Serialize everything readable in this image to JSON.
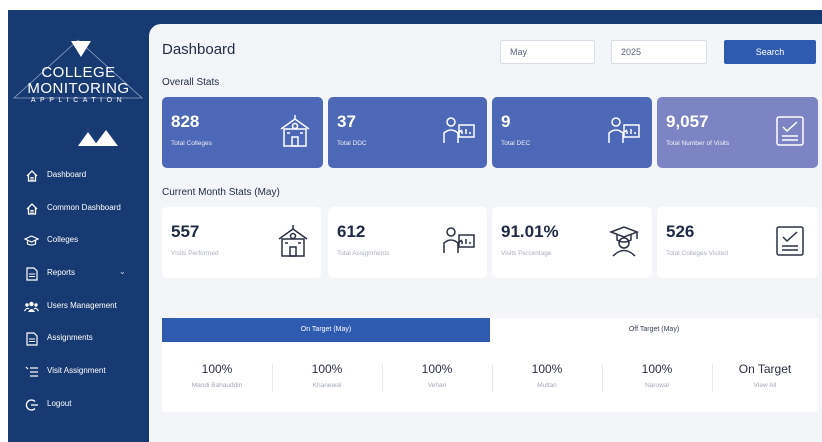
{
  "sidebar": {
    "logo": {
      "line1": "COLLEGE",
      "line2": "MONITORING",
      "line3": "APPLICATION"
    },
    "items": [
      {
        "label": "Dashboard",
        "icon": "home-icon"
      },
      {
        "label": "Common Dashboard",
        "icon": "home-icon"
      },
      {
        "label": "Colleges",
        "icon": "school-icon"
      },
      {
        "label": "Reports",
        "icon": "document-icon",
        "chevron": "⌄"
      },
      {
        "label": "Users Management",
        "icon": "users-icon"
      },
      {
        "label": "Assignments",
        "icon": "document-icon"
      },
      {
        "label": "Visit Assignment",
        "icon": "list-icon"
      },
      {
        "label": "Logout",
        "icon": "logout-icon"
      }
    ]
  },
  "header": {
    "title": "Dashboard",
    "month": "May",
    "year": "2025",
    "search_label": "Search"
  },
  "overall": {
    "heading": "Overall Stats",
    "cards": [
      {
        "value": "828",
        "label": "Total Colleges",
        "icon": "school-building-icon"
      },
      {
        "value": "37",
        "label": "Total DDC",
        "icon": "teacher-board-icon"
      },
      {
        "value": "9",
        "label": "Total DEC",
        "icon": "teacher-board-icon"
      },
      {
        "value": "9,057",
        "label": "Total Number of Visits",
        "icon": "checklist-icon"
      }
    ]
  },
  "current": {
    "heading": "Current Month Stats (May)",
    "cards": [
      {
        "value": "557",
        "label": "Visits Performed",
        "icon": "school-building-icon"
      },
      {
        "value": "612",
        "label": "Total Assignments",
        "icon": "teacher-board-icon"
      },
      {
        "value": "91.01%",
        "label": "Visits Percentage",
        "icon": "graduate-icon"
      },
      {
        "value": "526",
        "label": "Total Colleges Visited",
        "icon": "checklist-icon"
      }
    ]
  },
  "targets": {
    "tab_on": "On Target (May)",
    "tab_off": "Off Target (May)",
    "items": [
      {
        "value": "100%",
        "name": "Mandi Bahauddin"
      },
      {
        "value": "100%",
        "name": "Khanewal"
      },
      {
        "value": "100%",
        "name": "Vehari"
      },
      {
        "value": "100%",
        "name": "Multan"
      },
      {
        "value": "100%",
        "name": "Narowal"
      },
      {
        "value": "On Target",
        "name": "View All"
      }
    ]
  },
  "colors": {
    "sidebar": "#183a72",
    "accent": "#2e5bb0",
    "card_blue": "#4d68b6",
    "card_purple": "#7d84c3"
  }
}
